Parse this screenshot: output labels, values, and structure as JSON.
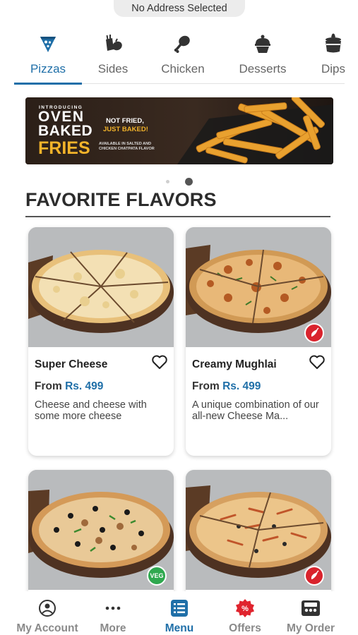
{
  "header": {
    "address": "No Address Selected"
  },
  "categories": [
    {
      "label": "Pizzas",
      "icon": "pizza-slice-icon",
      "active": true
    },
    {
      "label": "Sides",
      "icon": "sides-icon"
    },
    {
      "label": "Chicken",
      "icon": "chicken-leg-icon"
    },
    {
      "label": "Desserts",
      "icon": "cupcake-icon"
    },
    {
      "label": "Dips",
      "icon": "dip-cup-icon"
    }
  ],
  "banner": {
    "kicker": "INTRODUCING",
    "title_lines": [
      "OVEN",
      "BAKED",
      "FRIES"
    ],
    "tagline_1": "NOT FRIED,",
    "tagline_2": "JUST BAKED!",
    "fine_print_1": "AVAILABLE IN SALTED AND",
    "fine_print_2": "CHICKEN CHATPATA FLAVOR"
  },
  "carousel": {
    "count": 2,
    "active_index": 1
  },
  "section": {
    "title": "FAVORITE FLAVORS"
  },
  "products": [
    {
      "name": "Super Cheese",
      "price_prefix": "From",
      "price": "Rs. 499",
      "description": "Cheese and cheese with some more cheese",
      "badge": ""
    },
    {
      "name": "Creamy Mughlai",
      "price_prefix": "From",
      "price": "Rs. 499",
      "description": "A unique combination of our all-new Cheese Ma...",
      "badge": "spicy"
    },
    {
      "name": "",
      "price_prefix": "",
      "price": "",
      "description": "",
      "badge": "VEG"
    },
    {
      "name": "",
      "price_prefix": "",
      "price": "",
      "description": "",
      "badge": "spicy"
    }
  ],
  "bottom_nav": [
    {
      "label": "My Account",
      "icon": "user-circle-icon"
    },
    {
      "label": "More",
      "icon": "more-dots-icon"
    },
    {
      "label": "Menu",
      "icon": "menu-list-icon",
      "active": true
    },
    {
      "label": "Offers",
      "icon": "offer-badge-icon"
    },
    {
      "label": "My Order",
      "icon": "delivery-box-icon"
    }
  ],
  "colors": {
    "accent": "#1f6fa8",
    "spicy": "#d9232d",
    "veg": "#2fa84f",
    "offers": "#e0242e"
  }
}
